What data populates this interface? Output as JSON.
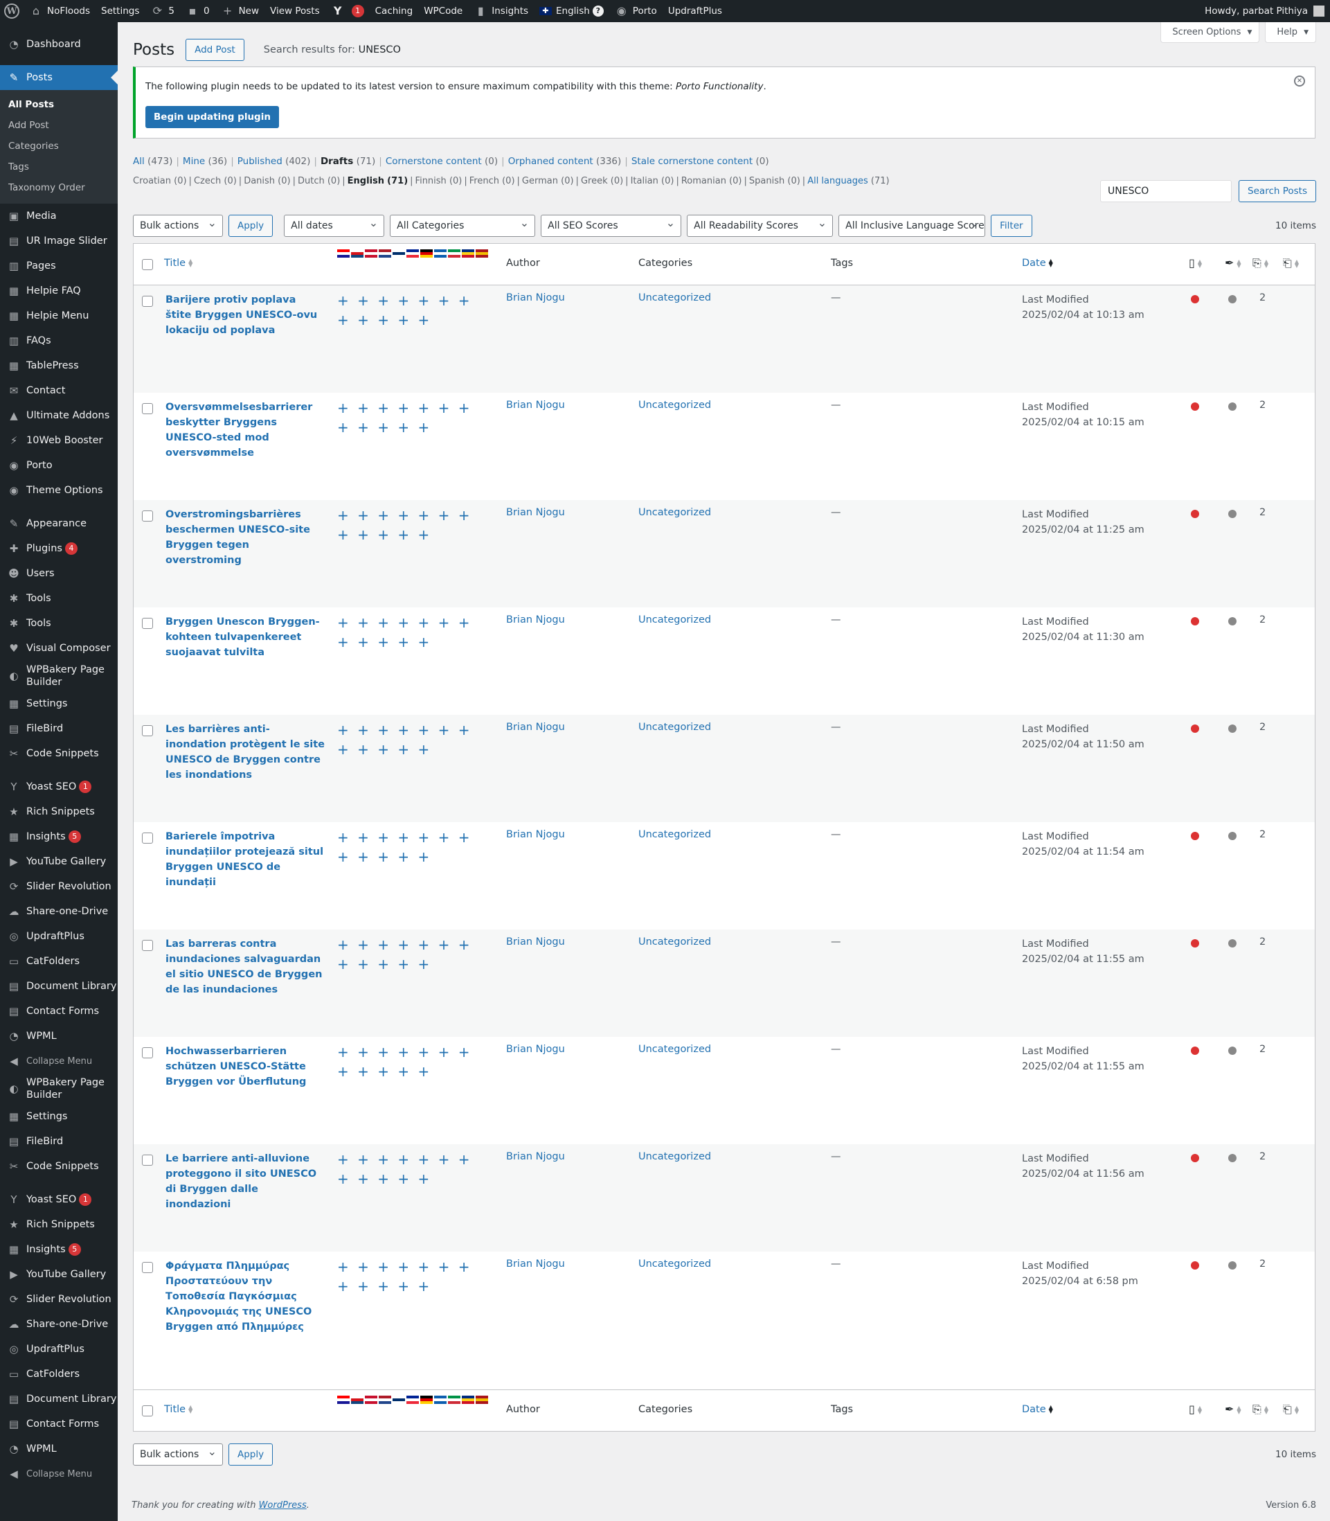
{
  "adminbar": {
    "site_name": "NoFloods",
    "settings": "Settings",
    "updates_count": "5",
    "comments_count": "0",
    "new_label": "New",
    "view_posts": "View Posts",
    "yoast_badge": "1",
    "caching": "Caching",
    "wpcode": "WPCode",
    "insights": "Insights",
    "language": "English",
    "porto": "Porto",
    "updraftplus": "UpdraftPlus",
    "howdy": "Howdy, parbat Pithiya"
  },
  "sidebar": {
    "dashboard": "Dashboard",
    "posts": "Posts",
    "submenu": [
      "All Posts",
      "Add Post",
      "Categories",
      "Tags",
      "Taxonomy Order"
    ],
    "items_a": [
      {
        "label": "Media",
        "icon": "▣"
      },
      {
        "label": "UR Image Slider",
        "icon": "▤"
      },
      {
        "label": "Pages",
        "icon": "▥"
      },
      {
        "label": "Helpie FAQ",
        "icon": "▦"
      },
      {
        "label": "Helpie Menu",
        "icon": "▦"
      },
      {
        "label": "FAQs",
        "icon": "▥"
      },
      {
        "label": "TablePress",
        "icon": "▦"
      },
      {
        "label": "Contact",
        "icon": "✉"
      },
      {
        "label": "Ultimate Addons",
        "icon": "▲"
      },
      {
        "label": "10Web Booster",
        "icon": "⚡"
      },
      {
        "label": "Porto",
        "icon": "◉"
      },
      {
        "label": "Theme Options",
        "icon": "◉"
      }
    ],
    "items_b": [
      {
        "label": "Appearance",
        "icon": "✎"
      },
      {
        "label": "Plugins",
        "icon": "✚",
        "badge": "4"
      },
      {
        "label": "Users",
        "icon": "☻"
      },
      {
        "label": "Tools",
        "icon": "✱"
      },
      {
        "label": "Tools",
        "icon": "✱"
      },
      {
        "label": "Visual Composer",
        "icon": "♥"
      },
      {
        "label": "WPBakery Page Builder",
        "icon": "◐",
        "two": true
      },
      {
        "label": "Settings",
        "icon": "▦"
      },
      {
        "label": "FileBird",
        "icon": "▤"
      },
      {
        "label": "Code Snippets",
        "icon": "✂"
      }
    ],
    "items_c": [
      {
        "label": "Yoast SEO",
        "icon": "Y",
        "badge": "1"
      },
      {
        "label": "Rich Snippets",
        "icon": "★"
      },
      {
        "label": "Insights",
        "icon": "▦",
        "badge": "5"
      },
      {
        "label": "YouTube Gallery",
        "icon": "▶"
      },
      {
        "label": "Slider Revolution",
        "icon": "⟳"
      },
      {
        "label": "Share-one-Drive",
        "icon": "☁"
      },
      {
        "label": "UpdraftPlus",
        "icon": "◎"
      },
      {
        "label": "CatFolders",
        "icon": "▭"
      },
      {
        "label": "Document Library",
        "icon": "▤"
      },
      {
        "label": "Contact Forms",
        "icon": "▤"
      },
      {
        "label": "WPML",
        "icon": "◔"
      },
      {
        "label": "Collapse Menu",
        "icon": "◀",
        "small": true
      },
      {
        "label": "WPBakery Page Builder",
        "icon": "◐",
        "two": true
      },
      {
        "label": "Settings",
        "icon": "▦"
      },
      {
        "label": "FileBird",
        "icon": "▤"
      },
      {
        "label": "Code Snippets",
        "icon": "✂"
      }
    ],
    "items_d": [
      {
        "label": "Yoast SEO",
        "icon": "Y",
        "badge": "1"
      },
      {
        "label": "Rich Snippets",
        "icon": "★"
      },
      {
        "label": "Insights",
        "icon": "▦",
        "badge": "5"
      },
      {
        "label": "YouTube Gallery",
        "icon": "▶"
      },
      {
        "label": "Slider Revolution",
        "icon": "⟳"
      },
      {
        "label": "Share-one-Drive",
        "icon": "☁"
      },
      {
        "label": "UpdraftPlus",
        "icon": "◎"
      },
      {
        "label": "CatFolders",
        "icon": "▭"
      },
      {
        "label": "Document Library",
        "icon": "▤"
      },
      {
        "label": "Contact Forms",
        "icon": "▤"
      },
      {
        "label": "WPML",
        "icon": "◔"
      },
      {
        "label": "Collapse Menu",
        "icon": "◀",
        "small": true
      }
    ]
  },
  "screen_options": "Screen Options",
  "help": "Help",
  "page": {
    "title": "Posts",
    "add_post": "Add Post",
    "subtitle_prefix": "Search results for: ",
    "subtitle_query": "UNESCO"
  },
  "notice": {
    "text": "The following plugin needs to be updated to its latest version to ensure maximum compatibility with this theme: ",
    "plugin": "Porto Functionality",
    "button": "Begin updating plugin"
  },
  "views": [
    {
      "label": "All",
      "count": "(473)"
    },
    {
      "label": "Mine",
      "count": "(36)"
    },
    {
      "label": "Published",
      "count": "(402)"
    },
    {
      "label": "Drafts",
      "count": "(71)",
      "current": true
    },
    {
      "label": "Cornerstone content",
      "count": "(0)"
    },
    {
      "label": "Orphaned content",
      "count": "(336)"
    },
    {
      "label": "Stale cornerstone content",
      "count": "(0)"
    }
  ],
  "languages": [
    {
      "label": "Croatian",
      "count": "(0)"
    },
    {
      "label": "Czech",
      "count": "(0)"
    },
    {
      "label": "Danish",
      "count": "(0)"
    },
    {
      "label": "Dutch",
      "count": "(0)"
    },
    {
      "label": "English",
      "count": "(71)",
      "current": true
    },
    {
      "label": "Finnish",
      "count": "(0)"
    },
    {
      "label": "French",
      "count": "(0)"
    },
    {
      "label": "German",
      "count": "(0)"
    },
    {
      "label": "Greek",
      "count": "(0)"
    },
    {
      "label": "Italian",
      "count": "(0)"
    },
    {
      "label": "Romanian",
      "count": "(0)"
    },
    {
      "label": "Spanish",
      "count": "(0)"
    },
    {
      "label": "All languages",
      "count": "(71)",
      "link": true
    }
  ],
  "search": {
    "value": "UNESCO",
    "button": "Search Posts"
  },
  "filters": {
    "bulk": "Bulk actions",
    "apply": "Apply",
    "dates": "All dates",
    "categories": "All Categories",
    "seo": "All SEO Scores",
    "readability": "All Readability Scores",
    "inclusive": "All Inclusive Language Scores",
    "filter": "Filter",
    "count": "10 items"
  },
  "columns": {
    "title": "Title",
    "author": "Author",
    "categories": "Categories",
    "tags": "Tags",
    "date": "Date"
  },
  "flag_colors": [
    [
      "#ff0000",
      "#ffffff",
      "#171796"
    ],
    [
      "#ffffff",
      "#d7141a",
      "#11457e"
    ],
    [
      "#c8102e",
      "#ffffff",
      "#c8102e"
    ],
    [
      "#ae1c28",
      "#ffffff",
      "#21468b"
    ],
    [
      "#ffffff",
      "#002f6c",
      "#ffffff"
    ],
    [
      "#002395",
      "#ffffff",
      "#ed2939"
    ],
    [
      "#000000",
      "#dd0000",
      "#ffce00"
    ],
    [
      "#0d5eaf",
      "#ffffff",
      "#0d5eaf"
    ],
    [
      "#009246",
      "#ffffff",
      "#ce2b37"
    ],
    [
      "#002b7f",
      "#fcd116",
      "#ce1126"
    ],
    [
      "#aa151b",
      "#f1bf00",
      "#aa151b"
    ]
  ],
  "plus_row": "+ + + + + + + + + + + +",
  "rows": [
    {
      "title": "Barijere protiv poplava štite Bryggen UNESCO-ovu lokaciju od poplava",
      "author": "Brian Njogu",
      "category": "Uncategorized",
      "tags": "—",
      "date_label": "Last Modified",
      "date": "2025/02/04 at 10:13 am",
      "links": "2"
    },
    {
      "title": "Oversvømmelsesbarrierer beskytter Bryggens UNESCO-sted mod oversvømmelse",
      "author": "Brian Njogu",
      "category": "Uncategorized",
      "tags": "—",
      "date_label": "Last Modified",
      "date": "2025/02/04 at 10:15 am",
      "links": "2"
    },
    {
      "title": "Overstromingsbarrières beschermen UNESCO-site Bryggen tegen overstroming",
      "author": "Brian Njogu",
      "category": "Uncategorized",
      "tags": "—",
      "date_label": "Last Modified",
      "date": "2025/02/04 at 11:25 am",
      "links": "2"
    },
    {
      "title": "Bryggen Unescon Bryggen-kohteen tulvapenkereet suojaavat tulvilta",
      "author": "Brian Njogu",
      "category": "Uncategorized",
      "tags": "—",
      "date_label": "Last Modified",
      "date": "2025/02/04 at 11:30 am",
      "links": "2"
    },
    {
      "title": "Les barrières anti-inondation protègent le site UNESCO de Bryggen contre les inondations",
      "author": "Brian Njogu",
      "category": "Uncategorized",
      "tags": "—",
      "date_label": "Last Modified",
      "date": "2025/02/04 at 11:50 am",
      "links": "2"
    },
    {
      "title": "Barierele împotriva inundațiilor protejează situl Bryggen UNESCO de inundații",
      "author": "Brian Njogu",
      "category": "Uncategorized",
      "tags": "—",
      "date_label": "Last Modified",
      "date": "2025/02/04 at 11:54 am",
      "links": "2"
    },
    {
      "title": "Las barreras contra inundaciones salvaguardan el sitio UNESCO de Bryggen de las inundaciones",
      "author": "Brian Njogu",
      "category": "Uncategorized",
      "tags": "—",
      "date_label": "Last Modified",
      "date": "2025/02/04 at 11:55 am",
      "links": "2"
    },
    {
      "title": "Hochwasserbarrieren schützen UNESCO-Stätte Bryggen vor Überflutung",
      "author": "Brian Njogu",
      "category": "Uncategorized",
      "tags": "—",
      "date_label": "Last Modified",
      "date": "2025/02/04 at 11:55 am",
      "links": "2"
    },
    {
      "title": "Le barriere anti-alluvione proteggono il sito UNESCO di Bryggen dalle inondazioni",
      "author": "Brian Njogu",
      "category": "Uncategorized",
      "tags": "—",
      "date_label": "Last Modified",
      "date": "2025/02/04 at 11:56 am",
      "links": "2"
    },
    {
      "title": "Φράγματα Πλημμύρας Προστατεύουν την Τοποθεσία Παγκόσμιας Κληρονομιάς της UNESCO Bryggen από Πλημμύρες",
      "author": "Brian Njogu",
      "category": "Uncategorized",
      "tags": "—",
      "date_label": "Last Modified",
      "date": "2025/02/04 at 6:58 pm",
      "links": "2",
      "tall": true
    }
  ],
  "footer": {
    "thanks": "Thank you for creating with ",
    "wp": "WordPress",
    "dot": ".",
    "version": "Version 6.8"
  }
}
